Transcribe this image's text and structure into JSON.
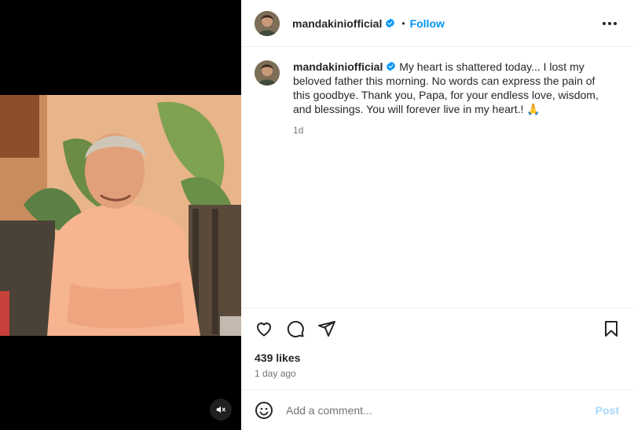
{
  "post": {
    "username": "mandakiniofficial",
    "follow_label": "Follow",
    "separator": "•",
    "caption": "My heart is shattered today... I lost my beloved father this morning. No words can express the pain of this goodbye. Thank you, Papa, for your endless love, wisdom, and blessings. You will forever live in my heart.! 🙏",
    "caption_time": "1d",
    "likes": "439 likes",
    "posted_ago": "1 day ago"
  },
  "comment": {
    "placeholder": "Add a comment...",
    "post_label": "Post"
  },
  "colors": {
    "accent": "#0095f6",
    "post_disabled": "#a8d8fb",
    "verified_badge": "#0095f6",
    "secondary_text": "#737373"
  },
  "icons": {
    "verified": "verified-badge-icon",
    "more": "more-options-icon",
    "like": "heart-icon",
    "comment": "comment-bubble-icon",
    "share": "paper-plane-icon",
    "save": "bookmark-icon",
    "emoji": "emoji-icon",
    "mute": "speaker-muted-icon"
  }
}
